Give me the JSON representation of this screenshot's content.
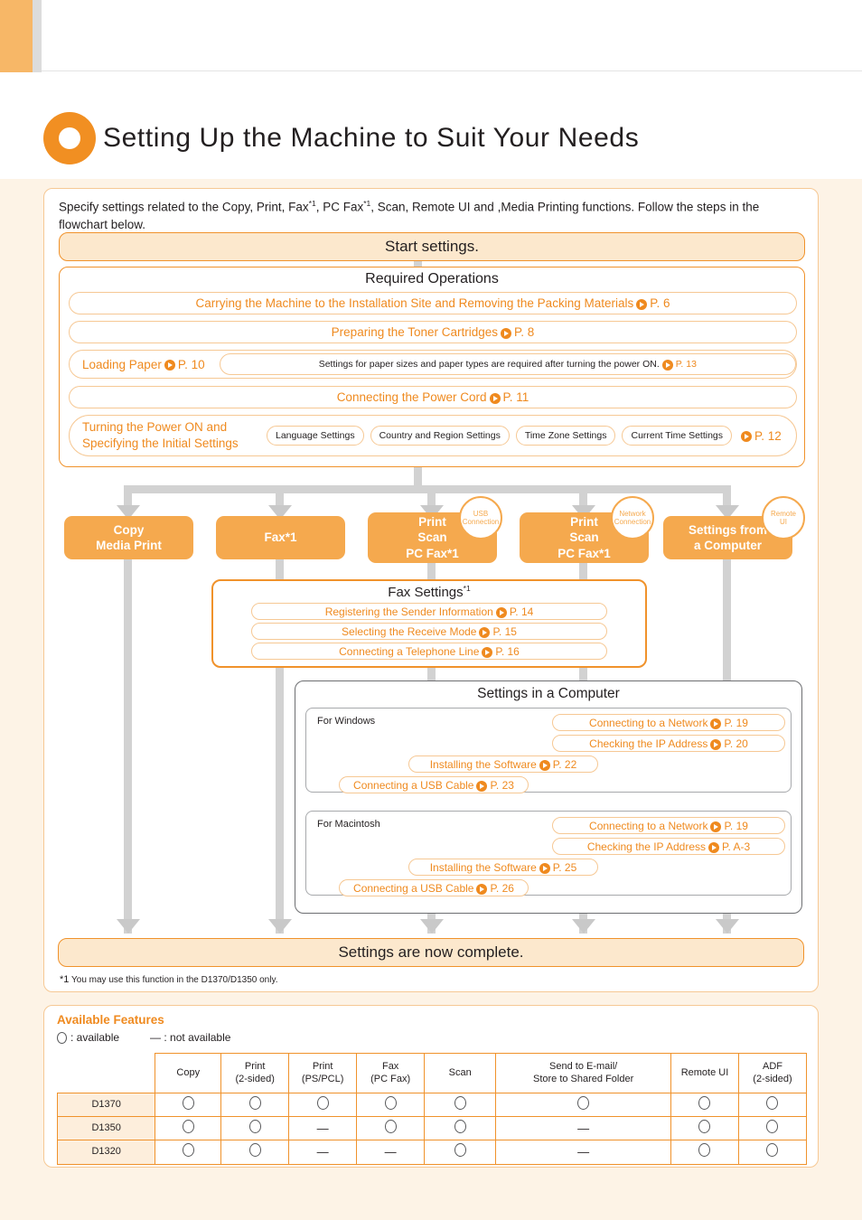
{
  "header": {
    "title": "Setting Up the Machine to Suit Your Needs"
  },
  "flow": {
    "intro": "Specify settings related to the Copy, Print, Fax *1, PC Fax *1, Scan, Remote UI and ,Media Printing functions. Follow the steps in the flowchart below.",
    "start_band": "Start settings.",
    "complete_band": "Settings are now complete.",
    "footnote_mark": "*1",
    "footnote_text": "You may use this function in the D1370/D1350 only.",
    "required": {
      "title": "Required Operations",
      "rows": [
        {
          "label": "Carrying the Machine to the Installation Site and Removing the Packing Materials",
          "page": "P. 6"
        },
        {
          "label": "Preparing the Toner Cartridges",
          "page": "P. 8"
        },
        {
          "label": "Loading Paper",
          "page": "P. 10",
          "note": "Settings for paper sizes and paper types are required after turning the power ON.",
          "note_page": "P. 13"
        },
        {
          "label": "Connecting the Power Cord",
          "page": "P. 11"
        },
        {
          "label": "Turning the Power ON and Specifying the Initial Settings",
          "page": "P. 12",
          "chips": [
            "Language Settings",
            "Country and Region Settings",
            "Time Zone Settings",
            "Current Time Settings"
          ]
        }
      ]
    },
    "branches": [
      {
        "lines": [
          "Copy",
          "Media Print"
        ]
      },
      {
        "lines": [
          "Fax*1"
        ]
      },
      {
        "lines": [
          "Print",
          "Scan",
          "PC Fax*1"
        ],
        "badge": [
          "USB",
          "Connection"
        ]
      },
      {
        "lines": [
          "Print",
          "Scan",
          "PC Fax*1"
        ],
        "badge": [
          "Network",
          "Connection"
        ]
      },
      {
        "lines": [
          "Settings from",
          "a Computer"
        ],
        "badge": [
          "Remote",
          "UI"
        ]
      }
    ],
    "fax_settings": {
      "title": "Fax Settings",
      "title_sup": "*1",
      "rows": [
        {
          "label": "Registering the Sender Information",
          "page": "P. 14"
        },
        {
          "label": "Selecting the Receive Mode",
          "page": "P. 15"
        },
        {
          "label": "Connecting a Telephone Line",
          "page": "P. 16"
        }
      ]
    },
    "computer_settings": {
      "title": "Settings in a Computer",
      "windows": {
        "label": "For Windows",
        "rows": [
          {
            "label": "Connecting to a Network",
            "page": "P. 19"
          },
          {
            "label": "Checking the IP Address",
            "page": "P. 20"
          },
          {
            "label": "Installing the Software",
            "page": "P. 22"
          },
          {
            "label": "Connecting a USB Cable",
            "page": "P. 23"
          }
        ]
      },
      "macintosh": {
        "label": "For Macintosh",
        "rows": [
          {
            "label": "Connecting to a Network",
            "page": "P. 19"
          },
          {
            "label": "Checking the IP Address",
            "page": "P. A-3"
          },
          {
            "label": "Installing the Software",
            "page": "P. 25"
          },
          {
            "label": "Connecting a USB Cable",
            "page": "P. 26"
          }
        ]
      }
    }
  },
  "features": {
    "title": "Available Features",
    "legend_available": ": available",
    "legend_not_available": "— : not available",
    "columns": [
      "",
      "Copy",
      "Print\n(2-sided)",
      "Print\n(PS/PCL)",
      "Fax\n(PC Fax)",
      "Scan",
      "Send to E-mail/\nStore to Shared Folder",
      "Remote UI",
      "ADF\n(2-sided)"
    ],
    "column_lines": [
      [
        ""
      ],
      [
        "Copy"
      ],
      [
        "Print",
        "(2-sided)"
      ],
      [
        "Print",
        "(PS/PCL)"
      ],
      [
        "Fax",
        "(PC Fax)"
      ],
      [
        "Scan"
      ],
      [
        "Send to E-mail/",
        "Store to Shared Folder"
      ],
      [
        "Remote UI"
      ],
      [
        "ADF",
        "(2-sided)"
      ]
    ],
    "rows": [
      {
        "model": "D1370",
        "cells": [
          "O",
          "O",
          "O",
          "O",
          "O",
          "O",
          "O",
          "O"
        ]
      },
      {
        "model": "D1350",
        "cells": [
          "O",
          "O",
          "-",
          "O",
          "O",
          "-",
          "O",
          "O"
        ]
      },
      {
        "model": "D1320",
        "cells": [
          "O",
          "O",
          "-",
          "-",
          "O",
          "-",
          "O",
          "O"
        ]
      }
    ]
  },
  "colors": {
    "accent_orange": "#ef8a1f",
    "branch_orange": "#f5a94e",
    "band_fill": "#fce8cd",
    "page_bg": "#fdf3e6",
    "connector_gray": "#d2d2d2"
  }
}
